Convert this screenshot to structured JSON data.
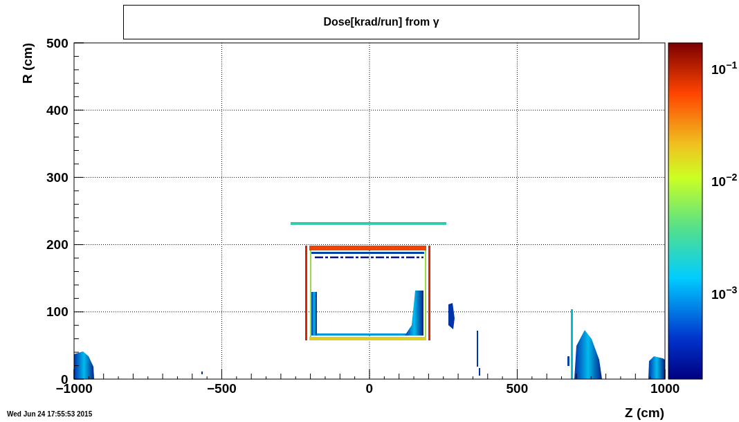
{
  "title": "Dose[krad/run] from γ",
  "xaxis": {
    "label": "Z (cm)",
    "ticks": [
      "−1000",
      "−500",
      "0",
      "500",
      "1000"
    ]
  },
  "yaxis": {
    "label": "R (cm)",
    "ticks": [
      "500",
      "400",
      "300",
      "200",
      "100",
      "0"
    ]
  },
  "color_scale": {
    "ticks": [
      "10$^{−1}$",
      "10$^{−2}$",
      "10$^{−3}$"
    ]
  },
  "timestamp": "Wed Jun 24 17:55:53 2015"
}
